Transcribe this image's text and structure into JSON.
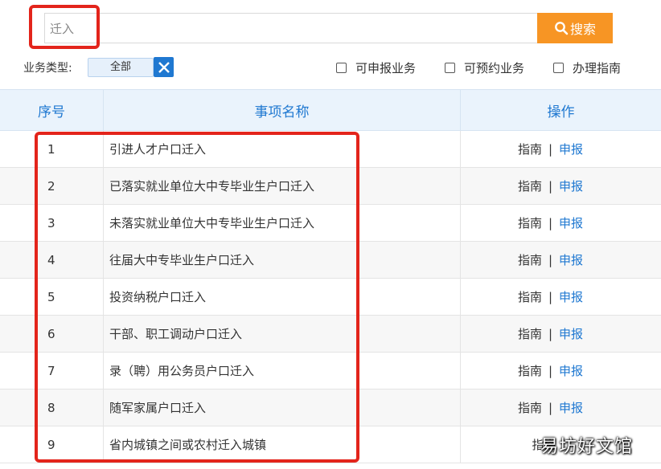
{
  "search": {
    "value": "迁入",
    "button_label": "搜索",
    "button_color": "#f79524"
  },
  "filter": {
    "type_label": "业务类型:",
    "selected_type": "全部",
    "checks": [
      {
        "label": "可申报业务",
        "checked": false
      },
      {
        "label": "可预约业务",
        "checked": false
      },
      {
        "label": "办理指南",
        "checked": false
      }
    ]
  },
  "table": {
    "headers": {
      "seq": "序号",
      "name": "事项名称",
      "op": "操作"
    },
    "rows": [
      {
        "seq": "1",
        "name": "引进人才户口迁入",
        "guide": "指南",
        "sep": "|",
        "apply": "申报"
      },
      {
        "seq": "2",
        "name": "已落实就业单位大中专毕业生户口迁入",
        "guide": "指南",
        "sep": "|",
        "apply": "申报"
      },
      {
        "seq": "3",
        "name": "未落实就业单位大中专毕业生户口迁入",
        "guide": "指南",
        "sep": "|",
        "apply": "申报"
      },
      {
        "seq": "4",
        "name": "往届大中专毕业生户口迁入",
        "guide": "指南",
        "sep": "|",
        "apply": "申报"
      },
      {
        "seq": "5",
        "name": "投资纳税户口迁入",
        "guide": "指南",
        "sep": "|",
        "apply": "申报"
      },
      {
        "seq": "6",
        "name": "干部、职工调动户口迁入",
        "guide": "指南",
        "sep": "|",
        "apply": "申报"
      },
      {
        "seq": "7",
        "name": "录（聘）用公务员户口迁入",
        "guide": "指南",
        "sep": "|",
        "apply": "申报"
      },
      {
        "seq": "8",
        "name": "随军家属户口迁入",
        "guide": "指南",
        "sep": "|",
        "apply": "申报"
      },
      {
        "seq": "9",
        "name": "省内城镇之间或农村迁入城镇",
        "guide": "指南",
        "sep": "",
        "apply": ""
      }
    ]
  },
  "watermark": "易坊好文馆",
  "colors": {
    "accent": "#1f78d1",
    "highlight": "#e3241b",
    "header_bg": "#eaf3fc"
  }
}
